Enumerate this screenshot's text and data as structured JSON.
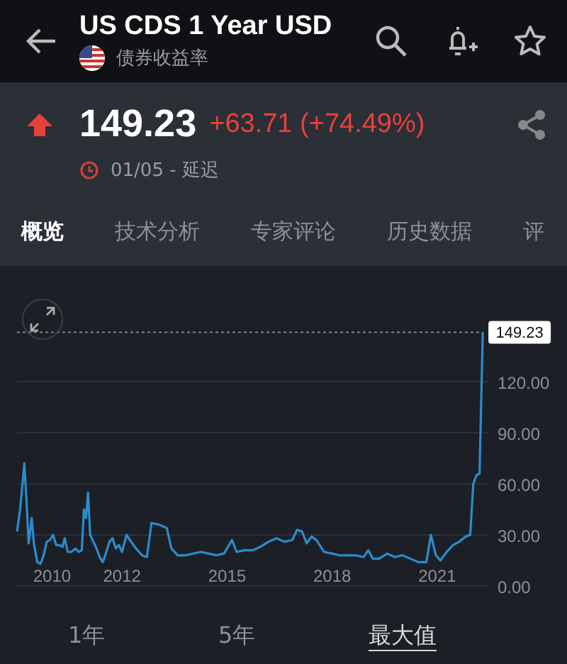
{
  "header": {
    "title": "US CDS 1 Year USD",
    "subtitle": "债券收益率"
  },
  "quote": {
    "price": "149.23",
    "change": "+63.71 (+74.49%)",
    "up": true,
    "time": "01/05 - 延迟"
  },
  "tabs": [
    {
      "label": "概览",
      "selected": true
    },
    {
      "label": "技术分析",
      "selected": false
    },
    {
      "label": "专家评论",
      "selected": false
    },
    {
      "label": "历史数据",
      "selected": false
    },
    {
      "label": "评",
      "selected": false
    }
  ],
  "chart": {
    "chart_data": {
      "type": "line",
      "grid": true,
      "xlim": [
        2009,
        2022.48
      ],
      "ylim": [
        0,
        150
      ],
      "xticks": [
        2010,
        2012,
        2015,
        2018,
        2021
      ],
      "yticks": [
        {
          "value": 0,
          "label": "0.00"
        },
        {
          "value": 30,
          "label": "30.00"
        },
        {
          "value": 60,
          "label": "60.00"
        },
        {
          "value": 90,
          "label": "90.00"
        },
        {
          "value": 120,
          "label": "120.00"
        }
      ],
      "x": [
        2009.0,
        2009.09,
        2009.21,
        2009.27,
        2009.33,
        2009.42,
        2009.48,
        2009.58,
        2009.67,
        2009.76,
        2009.85,
        2009.94,
        2010.03,
        2010.12,
        2010.21,
        2010.3,
        2010.36,
        2010.45,
        2010.55,
        2010.67,
        2010.76,
        2010.85,
        2010.91,
        2010.97,
        2011.03,
        2011.09,
        2011.18,
        2011.27,
        2011.36,
        2011.45,
        2011.55,
        2011.64,
        2011.73,
        2011.82,
        2011.91,
        2012.0,
        2012.13,
        2012.26,
        2012.4,
        2012.57,
        2012.71,
        2012.84,
        2013.06,
        2013.28,
        2013.41,
        2013.59,
        2013.81,
        2014.03,
        2014.25,
        2014.47,
        2014.69,
        2014.91,
        2015.14,
        2015.27,
        2015.5,
        2015.73,
        2015.95,
        2016.18,
        2016.41,
        2016.64,
        2016.86,
        2017.0,
        2017.14,
        2017.27,
        2017.41,
        2017.55,
        2017.77,
        2018.0,
        2018.22,
        2018.45,
        2018.67,
        2018.9,
        2019.03,
        2019.16,
        2019.34,
        2019.57,
        2019.79,
        2020.01,
        2020.24,
        2020.46,
        2020.69,
        2020.82,
        2020.96,
        2021.09,
        2021.27,
        2021.45,
        2021.63,
        2021.81,
        2021.94,
        2022.03,
        2022.12,
        2022.21,
        2022.3
      ],
      "series": [
        {
          "color": "#2a8ccc",
          "values": [
            32,
            45,
            72,
            50,
            25,
            40,
            25,
            14,
            13,
            18,
            26,
            27,
            30,
            24,
            24,
            23,
            28,
            20,
            20,
            22,
            20,
            21,
            45,
            40,
            55,
            30,
            26,
            22,
            17,
            14,
            20,
            26,
            28,
            22,
            24,
            20,
            30,
            26,
            22,
            18,
            17,
            37,
            36,
            34,
            22,
            18,
            18,
            19,
            20,
            19,
            18,
            19,
            27,
            20,
            21,
            21,
            23,
            26,
            28,
            26,
            27,
            33,
            32,
            25,
            29,
            27,
            20,
            19,
            18,
            18,
            18,
            17,
            21,
            16,
            16,
            19,
            17,
            18,
            16,
            14,
            14,
            30,
            18,
            15,
            20,
            24,
            26,
            29,
            30,
            60,
            65,
            66,
            149
          ]
        }
      ],
      "annotations": [
        {
          "x": 2022.3,
          "y": 149,
          "text": "149.23"
        }
      ]
    }
  },
  "ranges": [
    {
      "label": "1年",
      "selected": false
    },
    {
      "label": "5年",
      "selected": false
    },
    {
      "label": "最大值",
      "selected": true
    }
  ]
}
